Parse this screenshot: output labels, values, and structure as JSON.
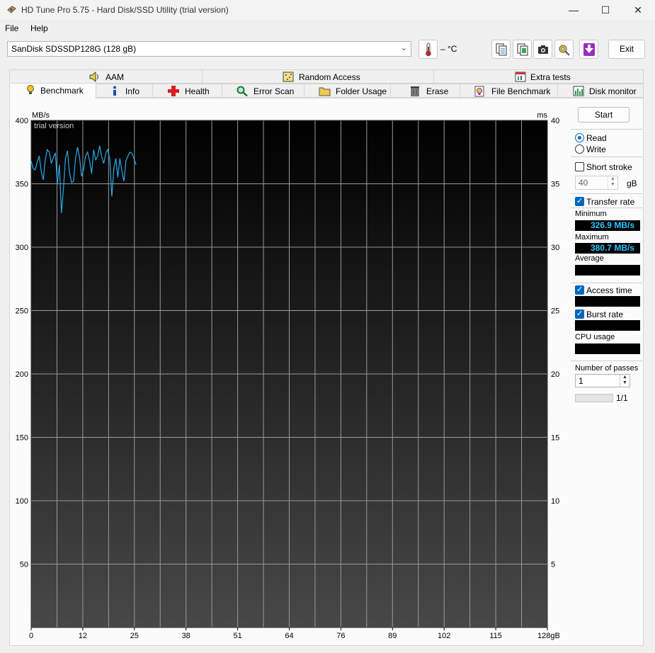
{
  "window": {
    "title": "HD Tune Pro 5.75 - Hard Disk/SSD Utility (trial version)",
    "controls": [
      "—",
      "☐",
      "✕"
    ]
  },
  "menu": {
    "file": "File",
    "help": "Help"
  },
  "toolbar": {
    "drive": "SanDisk SDSSDP128G (128 gB)",
    "temperature": "– °C",
    "exit_label": "Exit"
  },
  "tabs_top": [
    {
      "label": "AAM"
    },
    {
      "label": "Random Access"
    },
    {
      "label": "Extra tests"
    }
  ],
  "tabs_bottom": [
    {
      "label": "Benchmark"
    },
    {
      "label": "Info"
    },
    {
      "label": "Health"
    },
    {
      "label": "Error Scan"
    },
    {
      "label": "Folder Usage"
    },
    {
      "label": "Erase"
    },
    {
      "label": "File Benchmark"
    },
    {
      "label": "Disk monitor"
    }
  ],
  "side_panel": {
    "start_label": "Start",
    "read_label": "Read",
    "write_label": "Write",
    "read_selected": true,
    "short_stroke_label": "Short stroke",
    "short_stroke_checked": false,
    "short_stroke_value": "40",
    "short_stroke_unit": "gB",
    "transfer_rate_label": "Transfer rate",
    "transfer_rate_checked": true,
    "minimum_label": "Minimum",
    "minimum_value": "326.9 MB/s",
    "maximum_label": "Maximum",
    "maximum_value": "380.7 MB/s",
    "average_label": "Average",
    "average_value": "",
    "access_time_label": "Access time",
    "access_time_checked": true,
    "access_time_value": "",
    "burst_rate_label": "Burst rate",
    "burst_rate_checked": true,
    "burst_rate_value": "",
    "cpu_usage_label": "CPU usage",
    "cpu_usage_value": "",
    "passes_label": "Number of passes",
    "passes_value": "1",
    "pass_progress_label": "1/1",
    "pass_progress_fraction": 0
  },
  "chart_data": {
    "type": "line",
    "watermark": "trial version",
    "ylabel": "MB/s",
    "y2label": "ms",
    "xunit": "gB",
    "ylim": [
      0,
      400
    ],
    "y2lim": [
      0,
      40
    ],
    "xlim": [
      0,
      128
    ],
    "yticks": [
      "400",
      "350",
      "300",
      "250",
      "200",
      "150",
      "100",
      "50"
    ],
    "yticks_values": [
      400,
      350,
      300,
      250,
      200,
      150,
      100,
      50
    ],
    "y2ticks": [
      "40",
      "35",
      "30",
      "25",
      "20",
      "15",
      "10",
      "5"
    ],
    "xticks": [
      "0",
      "12",
      "25",
      "38",
      "51",
      "64",
      "76",
      "89",
      "102",
      "115",
      "128gB"
    ],
    "xticks_values": [
      0,
      12.8,
      25.6,
      38.4,
      51.2,
      64,
      76.8,
      89.6,
      102.4,
      115.2,
      128
    ],
    "grid": true,
    "line_color": "#2aa8e6",
    "series": [
      {
        "x": [
          0,
          0.5,
          1,
          1.5,
          2,
          2.5,
          3,
          3.5,
          4,
          4.5,
          5,
          5.5,
          6,
          6.5,
          7,
          7.5,
          8,
          8.5,
          9,
          9.5,
          10,
          10.5,
          11,
          11.5,
          12,
          12.5,
          13,
          13.5,
          14,
          14.5,
          15,
          15.5,
          16,
          16.5,
          17,
          17.5,
          18,
          18.5,
          19,
          19.5,
          20,
          20.5,
          21,
          21.5,
          22,
          22.5,
          23,
          23.5,
          24,
          24.5,
          25,
          25.5,
          26
        ],
        "values": [
          368,
          362,
          361,
          367,
          372,
          360,
          353,
          369,
          377,
          375,
          366,
          371,
          374,
          350,
          365,
          327,
          346,
          370,
          376,
          359,
          351,
          352,
          370,
          379,
          371,
          356,
          361,
          372,
          375,
          368,
          358,
          377,
          369,
          372,
          380,
          371,
          366,
          374,
          377,
          369,
          340,
          362,
          370,
          355,
          370,
          360,
          352,
          368,
          372,
          375,
          374,
          370,
          365
        ]
      }
    ]
  }
}
